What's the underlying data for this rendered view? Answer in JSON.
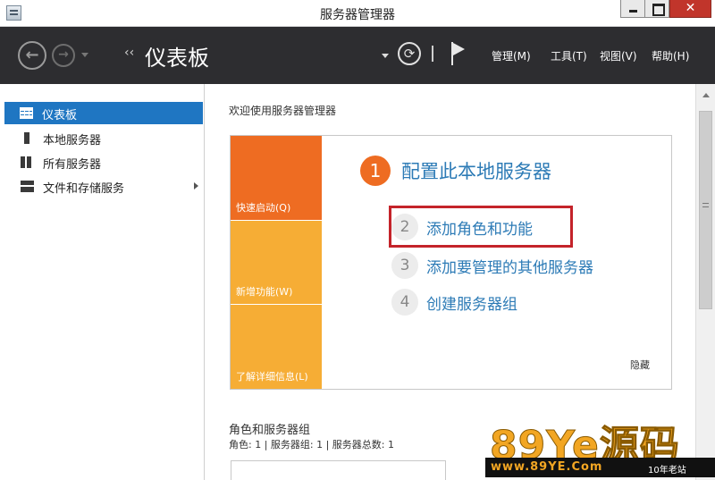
{
  "window": {
    "title": "服务器管理器",
    "close_glyph": "✕"
  },
  "header": {
    "back_glyph": "←",
    "forward_glyph": "→",
    "crumb_chevron": "‹‹",
    "page_title": "仪表板",
    "refresh_glyph": "⟳",
    "menus": [
      "管理(M)",
      "工具(T)",
      "视图(V)",
      "帮助(H)"
    ]
  },
  "sidebar": {
    "items": [
      {
        "label": "仪表板",
        "icon": "dashboard-icon",
        "selected": true
      },
      {
        "label": "本地服务器",
        "icon": "server-icon"
      },
      {
        "label": "所有服务器",
        "icon": "servers-icon"
      },
      {
        "label": "文件和存储服务",
        "icon": "files-storage-icon",
        "has_submenu": true
      }
    ]
  },
  "main": {
    "welcome": "欢迎使用服务器管理器",
    "tiles": [
      "快速启动(Q)",
      "新增功能(W)",
      "了解详细信息(L)"
    ],
    "steps": [
      {
        "num": "1",
        "label": "配置此本地服务器"
      },
      {
        "num": "2",
        "label": "添加角色和功能"
      },
      {
        "num": "3",
        "label": "添加要管理的其他服务器"
      },
      {
        "num": "4",
        "label": "创建服务器组"
      }
    ],
    "hide_link": "隐藏",
    "roles_title": "角色和服务器组",
    "roles_summary": "角色: 1 | 服务器组: 1 | 服务器总数: 1"
  },
  "colors": {
    "header_bg": "#2d2d30",
    "accent_blue": "#1f76c2",
    "tile_orange": "#ee6c22",
    "tile_yellow": "#f6ad35",
    "highlight_red": "#c4232a"
  },
  "watermark": {
    "logo": "89Ye源码",
    "url": "www.89YE.Com",
    "tag": "10年老站"
  }
}
